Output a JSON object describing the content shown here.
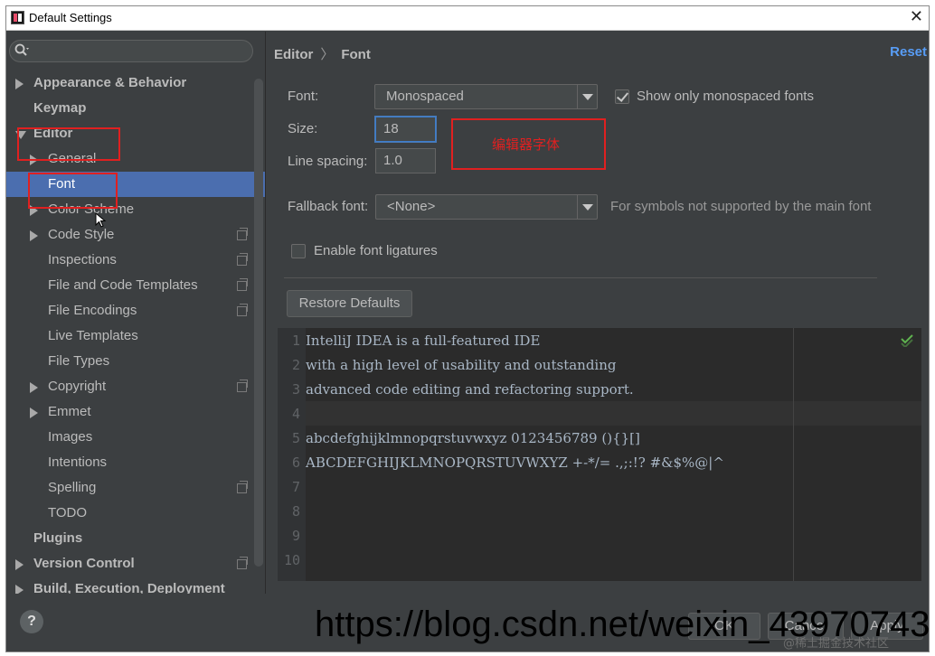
{
  "window": {
    "title": "Default Settings",
    "close": "✕"
  },
  "sidebar": {
    "items": [
      {
        "label": "Appearance & Behavior",
        "level": 0,
        "arrow": "right",
        "bold": true
      },
      {
        "label": "Keymap",
        "level": 0,
        "arrow": "none",
        "bold": true
      },
      {
        "label": "Editor",
        "level": 0,
        "arrow": "down",
        "bold": true
      },
      {
        "label": "General",
        "level": 1,
        "arrow": "right"
      },
      {
        "label": "Font",
        "level": 1,
        "arrow": "none",
        "selected": true
      },
      {
        "label": "Color Scheme",
        "level": 1,
        "arrow": "right"
      },
      {
        "label": "Code Style",
        "level": 1,
        "arrow": "right",
        "copy_icon": true
      },
      {
        "label": "Inspections",
        "level": 1,
        "arrow": "none",
        "copy_icon": true
      },
      {
        "label": "File and Code Templates",
        "level": 1,
        "arrow": "none",
        "copy_icon": true
      },
      {
        "label": "File Encodings",
        "level": 1,
        "arrow": "none",
        "copy_icon": true
      },
      {
        "label": "Live Templates",
        "level": 1,
        "arrow": "none"
      },
      {
        "label": "File Types",
        "level": 1,
        "arrow": "none"
      },
      {
        "label": "Copyright",
        "level": 1,
        "arrow": "right",
        "copy_icon": true
      },
      {
        "label": "Emmet",
        "level": 1,
        "arrow": "right"
      },
      {
        "label": "Images",
        "level": 1,
        "arrow": "none"
      },
      {
        "label": "Intentions",
        "level": 1,
        "arrow": "none"
      },
      {
        "label": "Spelling",
        "level": 1,
        "arrow": "none",
        "copy_icon": true
      },
      {
        "label": "TODO",
        "level": 1,
        "arrow": "none"
      },
      {
        "label": "Plugins",
        "level": 0,
        "arrow": "none",
        "bold": true
      },
      {
        "label": "Version Control",
        "level": 0,
        "arrow": "right",
        "bold": true,
        "copy_icon": true
      },
      {
        "label": "Build, Execution, Deployment",
        "level": 0,
        "arrow": "right",
        "bold": true
      }
    ]
  },
  "breadcrumb": {
    "parent": "Editor",
    "separator": "〉",
    "current": "Font"
  },
  "reset_label": "Reset",
  "font_settings": {
    "font_label": "Font:",
    "font_value": "Monospaced",
    "show_mono_label": "Show only monospaced fonts",
    "show_mono_checked": true,
    "size_label": "Size:",
    "size_value": "18",
    "line_spacing_label": "Line spacing:",
    "line_spacing_value": "1.0",
    "fallback_label": "Fallback font:",
    "fallback_value": "<None>",
    "fallback_hint": "For symbols not supported by the main font",
    "ligatures_label": "Enable font ligatures",
    "ligatures_checked": false,
    "restore_label": "Restore Defaults"
  },
  "annotation": {
    "text": "编辑器字体",
    "color": "#e02020"
  },
  "preview": {
    "line_numbers": [
      "1",
      "2",
      "3",
      "4",
      "5",
      "6",
      "7",
      "8",
      "9",
      "10"
    ],
    "lines": [
      "IntelliJ IDEA is a full-featured IDE",
      "with a high level of usability and outstanding",
      "advanced code editing and refactoring support.",
      "",
      "abcdefghijklmnopqrstuvwxyz 0123456789 (){}[]",
      "ABCDEFGHIJKLMNOPQRSTUVWXYZ +-*/= .,;:!? #&$%@|^"
    ]
  },
  "footer": {
    "help": "?",
    "ok_label": "OK",
    "cancel_label": "Cancel",
    "apply_label": "Apply"
  },
  "watermark": {
    "url": "https://blog.csdn.net/weixin_43970743",
    "sub": "@稀土掘金技术社区"
  },
  "colors": {
    "accent": "#4b6eaf",
    "link": "#589df6",
    "background": "#3c3f41",
    "annotation": "#e02020"
  }
}
